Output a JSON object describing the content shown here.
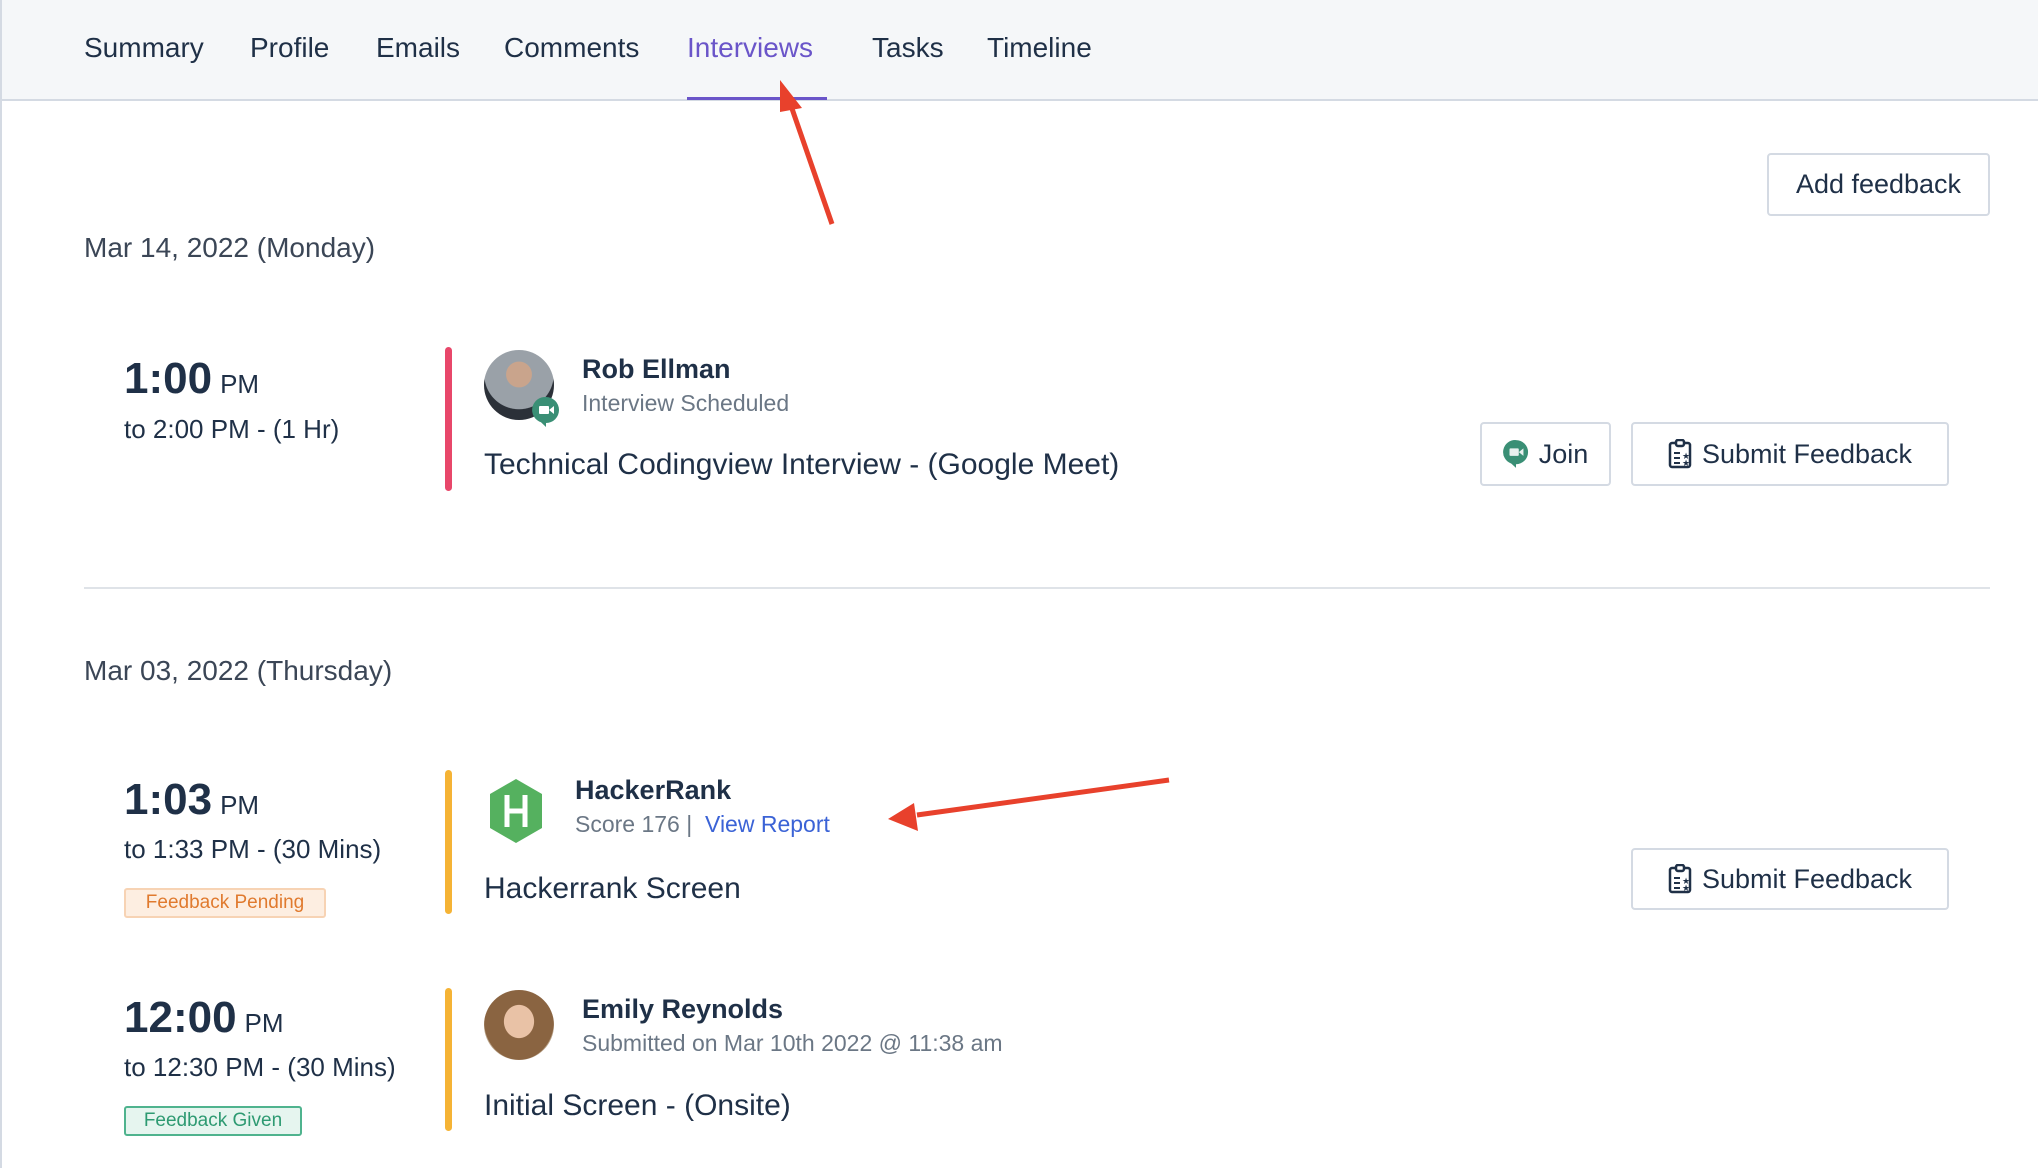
{
  "tabs": [
    {
      "label": "Summary"
    },
    {
      "label": "Profile"
    },
    {
      "label": "Emails"
    },
    {
      "label": "Comments"
    },
    {
      "label": "Interviews",
      "active": true
    },
    {
      "label": "Tasks"
    },
    {
      "label": "Timeline"
    }
  ],
  "add_feedback_label": "Add feedback",
  "accent_color": "#6a55c9",
  "groups": [
    {
      "date": "Mar 14, 2022 (Monday)",
      "interviews": [
        {
          "start": "1:00",
          "ampm": "PM",
          "end": "to 2:00 PM - (1 Hr)",
          "bar_color": "#e8476a",
          "person": "Rob Ellman",
          "status": "Interview Scheduled",
          "title": "Technical Codingview Interview  - (Google Meet)",
          "icon": "google-meet-icon",
          "join_label": "Join",
          "submit_label": "Submit Feedback"
        }
      ]
    },
    {
      "date": "Mar 03, 2022 (Thursday)",
      "interviews": [
        {
          "start": "1:03",
          "ampm": "PM",
          "end": "to 1:33 PM - (30 Mins)",
          "bar_color": "#f5b335",
          "badge": "Feedback Pending",
          "person": "HackerRank",
          "score": "Score 176",
          "separator": "|",
          "link": "View Report",
          "title": "Hackerrank Screen",
          "icon": "hackerrank-logo-icon",
          "submit_label": "Submit Feedback"
        },
        {
          "start": "12:00",
          "ampm": "PM",
          "end": "to 12:30 PM - (30 Mins)",
          "bar_color": "#f5b335",
          "badge": "Feedback Given",
          "person": "Emily Reynolds",
          "status": "Submitted on Mar 10th 2022 @ 11:38 am",
          "title": "Initial Screen  - (Onsite)"
        }
      ]
    }
  ]
}
